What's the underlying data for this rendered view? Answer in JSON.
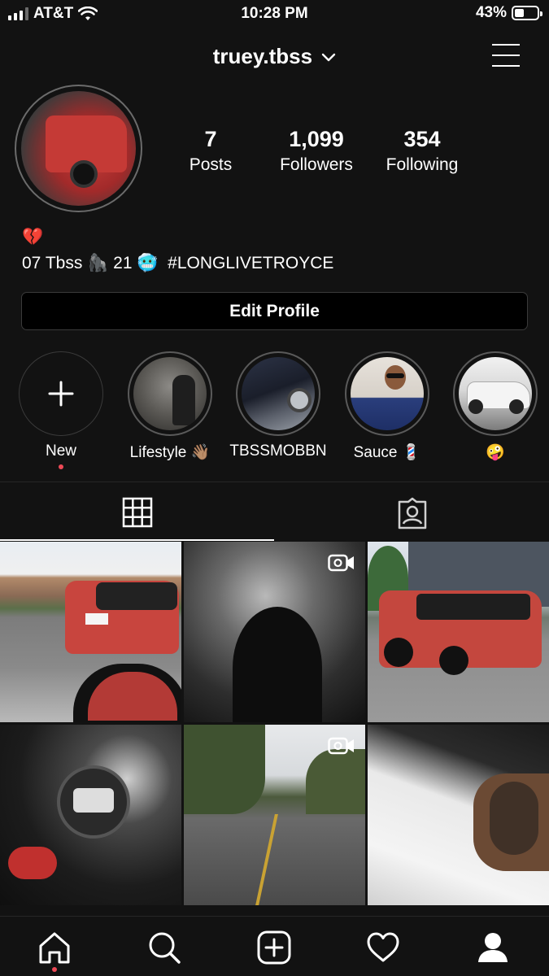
{
  "status_bar": {
    "carrier": "AT&T",
    "time": "10:28 PM",
    "battery": "43%",
    "battery_level": 0.43
  },
  "header": {
    "username": "truey.tbss"
  },
  "stats": [
    {
      "value": "7",
      "label": "Posts"
    },
    {
      "value": "1,099",
      "label": "Followers"
    },
    {
      "value": "354",
      "label": "Following"
    }
  ],
  "bio": {
    "line1": "💔",
    "line2": "07 Tbss 🦍 21 🥶  #LONGLIVETROYCE"
  },
  "edit_profile_label": "Edit Profile",
  "highlights": [
    {
      "label": "New"
    },
    {
      "label": "Lifestyle 👋🏽"
    },
    {
      "label": "TBSSMOBBN"
    },
    {
      "label": "Sauce 💈"
    },
    {
      "label": "🤪"
    }
  ],
  "icons": {
    "menu": "menu-icon",
    "grid_tab": "grid-icon",
    "tagged_tab": "tagged-icon",
    "home": "home-icon",
    "search": "search-icon",
    "new_post": "add-post-icon",
    "activity": "heart-icon",
    "profile": "profile-icon"
  },
  "colors": {
    "background": "#121212",
    "notification_dot": "#ed4956"
  }
}
